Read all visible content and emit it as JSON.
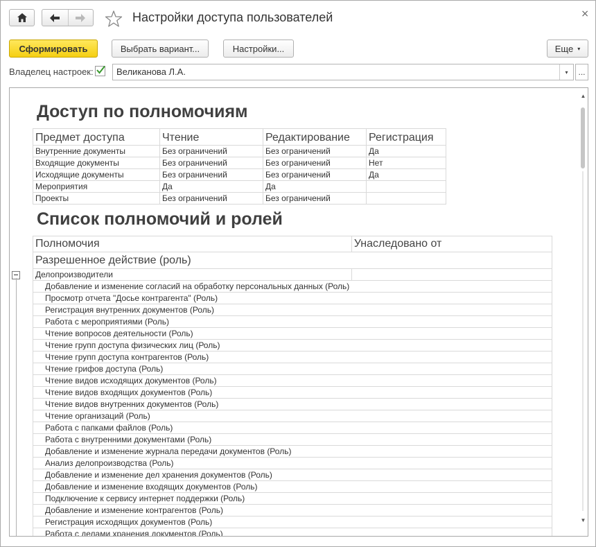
{
  "window": {
    "title": "Настройки доступа пользователей",
    "close_glyph": "×",
    "icons": {
      "home": "home-icon",
      "back": "arrow-left-icon",
      "forward": "arrow-right-icon",
      "favorite": "star-icon"
    }
  },
  "toolbar": {
    "generate_label": "Сформировать",
    "variant_label": "Выбрать вариант...",
    "settings_label": "Настройки...",
    "more_label": "Еще",
    "more_caret": "▾"
  },
  "owner": {
    "label": "Владелец настроек:",
    "checked": true,
    "value": "Великанова Л.А.",
    "dropdown_glyph": "▾",
    "more_glyph": "..."
  },
  "colors": {
    "primary_button": "#f5cf13",
    "check": "#3a9a2e"
  },
  "report": {
    "section1_title": "Доступ по полномочиям",
    "access_table": {
      "headers": [
        "Предмет доступа",
        "Чтение",
        "Редактирование",
        "Регистрация"
      ],
      "rows": [
        [
          "Внутренние документы",
          "Без ограничений",
          "Без ограничений",
          "Да"
        ],
        [
          "Входящие документы",
          "Без ограничений",
          "Без ограничений",
          "Нет"
        ],
        [
          "Исходящие документы",
          "Без ограничений",
          "Без ограничений",
          "Да"
        ],
        [
          "Мероприятия",
          "Да",
          "Да",
          ""
        ],
        [
          "Проекты",
          "Без ограничений",
          "Без ограничений",
          ""
        ]
      ]
    },
    "section2_title": "Список полномочий и ролей",
    "roles_table": {
      "headers": [
        "Полномочия",
        "Унаследовано от"
      ],
      "subheader": "Разрешенное действие (роль)",
      "group": "Делопроизводители",
      "roles": [
        "Добавление и изменение согласий на обработку персональных данных (Роль)",
        "Просмотр отчета \"Досье контрагента\" (Роль)",
        "Регистрация внутренних документов (Роль)",
        "Работа с мероприятиями (Роль)",
        "Чтение вопросов деятельности (Роль)",
        "Чтение групп доступа физических лиц (Роль)",
        "Чтение групп доступа контрагентов (Роль)",
        "Чтение грифов доступа (Роль)",
        "Чтение видов исходящих документов (Роль)",
        "Чтение видов входящих документов (Роль)",
        "Чтение видов внутренних документов (Роль)",
        "Чтение организаций (Роль)",
        "Работа с папками файлов (Роль)",
        "Работа с внутренними документами (Роль)",
        "Добавление и изменение журнала передачи документов (Роль)",
        "Анализ делопроизводства (Роль)",
        "Добавление и изменение дел хранения документов (Роль)",
        "Добавление и изменение входящих документов (Роль)",
        "Подключение к сервису интернет поддержки (Роль)",
        "Добавление и изменение контрагентов (Роль)",
        "Регистрация исходящих документов (Роль)",
        "Работа с делами хранения документов (Роль)"
      ]
    }
  }
}
